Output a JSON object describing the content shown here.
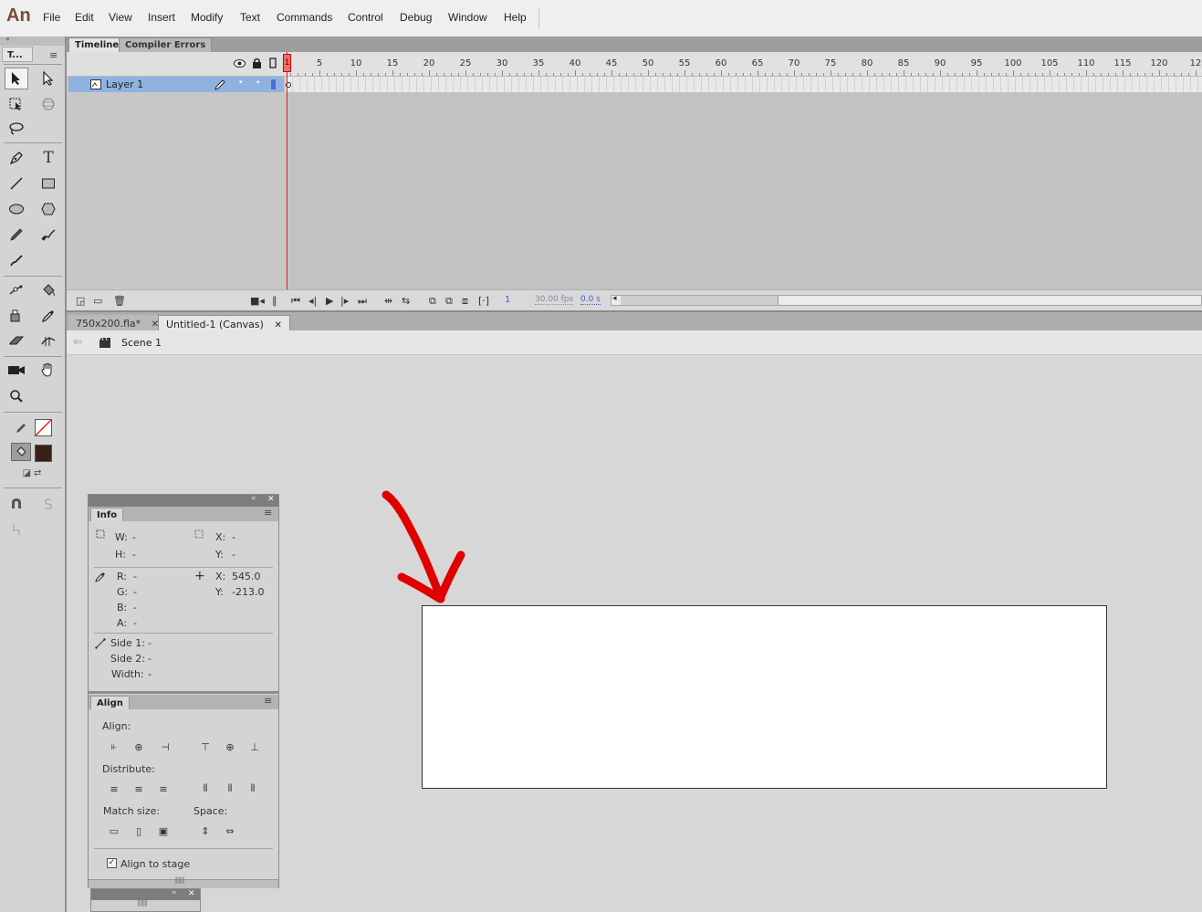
{
  "app": {
    "logo": "An"
  },
  "menu": [
    "File",
    "Edit",
    "View",
    "Insert",
    "Modify",
    "Text",
    "Commands",
    "Control",
    "Debug",
    "Window",
    "Help"
  ],
  "tools": {
    "panel_tab": "T..."
  },
  "timeline": {
    "tabs": [
      "Timeline",
      "Compiler Errors"
    ],
    "layer_name": "Layer 1",
    "ruler_numbers": [
      "5",
      "10",
      "15",
      "20",
      "25",
      "30",
      "35",
      "40",
      "45",
      "50",
      "55",
      "60",
      "65",
      "70",
      "75",
      "80",
      "85",
      "90",
      "95",
      "100",
      "105",
      "110",
      "115",
      "120",
      "12"
    ],
    "playhead_frame": "1",
    "current_frame": "1",
    "fps": "30.00 fps",
    "time": "0.0 s"
  },
  "documents": {
    "tabs": [
      {
        "label": "750x200.fla*",
        "active": false
      },
      {
        "label": "Untitled-1 (Canvas)",
        "active": true
      }
    ],
    "scene": "Scene 1"
  },
  "info_panel": {
    "tab": "Info",
    "w_label": "W:",
    "w_value": "-",
    "h_label": "H:",
    "h_value": "-",
    "x_label": "X:",
    "x_value": "-",
    "y_label": "Y:",
    "y_value": "-",
    "r_label": "R:",
    "r_value": "-",
    "g_label": "G:",
    "g_value": "-",
    "b_label": "B:",
    "b_value": "-",
    "a_label": "A:",
    "a_value": "-",
    "cursor_x_label": "X:",
    "cursor_x_value": "545.0",
    "cursor_y_label": "Y:",
    "cursor_y_value": "-213.0",
    "side1_label": "Side 1:",
    "side1_value": "-",
    "side2_label": "Side 2:",
    "side2_value": "-",
    "width_label": "Width:",
    "width_value": "-"
  },
  "align_panel": {
    "tab": "Align",
    "align_label": "Align:",
    "distribute_label": "Distribute:",
    "match_size_label": "Match size:",
    "space_label": "Space:",
    "align_to_stage_label": "Align to stage",
    "align_to_stage_checked": true
  },
  "colors": {
    "stroke": "#ffffff",
    "fill": "#3b2018",
    "annotation_arrow": "#e00000",
    "layer_highlight": "#8eb3e0"
  }
}
